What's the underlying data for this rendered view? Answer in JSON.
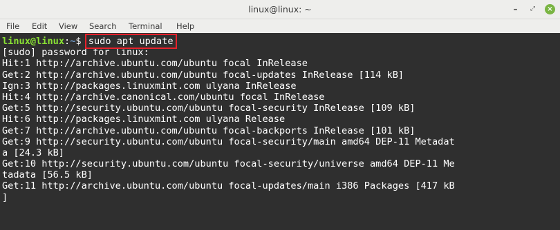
{
  "window": {
    "title": "linux@linux: ~",
    "minimize_glyph": "–",
    "maximize_glyph": "⤢",
    "close_glyph": "×",
    "close_color": "#7ab543"
  },
  "menu": [
    "File",
    "Edit",
    "View",
    "Search",
    "Terminal",
    "Help"
  ],
  "prompt": {
    "user_host": "linux@linux",
    "sep": ":",
    "path": "~",
    "symbol": "$ ",
    "command": "sudo apt update"
  },
  "colors": {
    "prompt_user": "#8ae234",
    "prompt_path": "#729fcf",
    "highlight_box": "#e8212b",
    "terminal_bg": "#2f2f2f"
  },
  "output": [
    "[sudo] password for linux:",
    "Hit:1 http://archive.ubuntu.com/ubuntu focal InRelease",
    "Get:2 http://archive.ubuntu.com/ubuntu focal-updates InRelease [114 kB]",
    "Ign:3 http://packages.linuxmint.com ulyana InRelease",
    "Hit:4 http://archive.canonical.com/ubuntu focal InRelease",
    "Get:5 http://security.ubuntu.com/ubuntu focal-security InRelease [109 kB]",
    "Hit:6 http://packages.linuxmint.com ulyana Release",
    "Get:7 http://archive.ubuntu.com/ubuntu focal-backports InRelease [101 kB]",
    "Get:9 http://security.ubuntu.com/ubuntu focal-security/main amd64 DEP-11 Metadat",
    "a [24.3 kB]",
    "Get:10 http://security.ubuntu.com/ubuntu focal-security/universe amd64 DEP-11 Me",
    "tadata [56.5 kB]",
    "Get:11 http://archive.ubuntu.com/ubuntu focal-updates/main i386 Packages [417 kB",
    "]"
  ]
}
